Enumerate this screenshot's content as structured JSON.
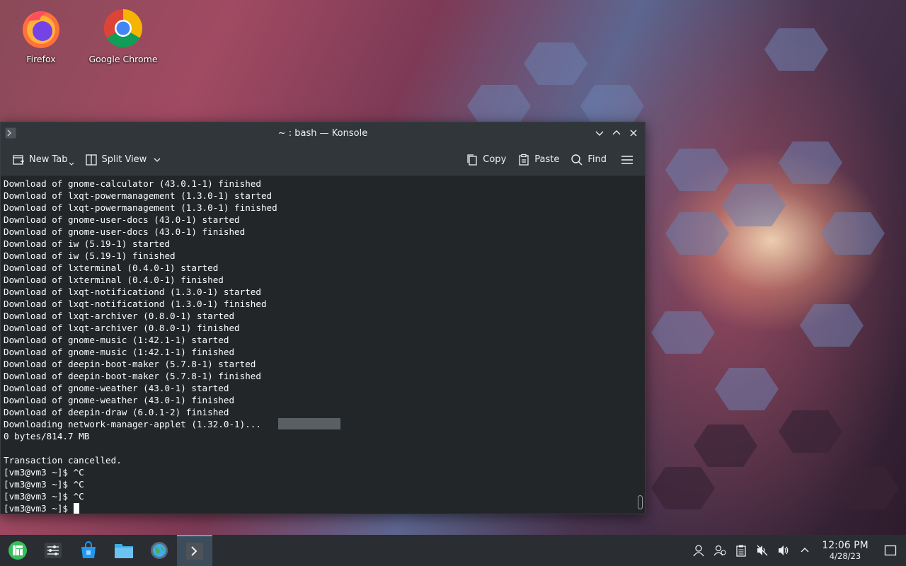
{
  "desktop": {
    "icons": [
      {
        "label": "Firefox",
        "icon": "firefox-icon"
      },
      {
        "label": "Google Chrome",
        "icon": "chrome-icon"
      }
    ]
  },
  "window": {
    "title": "~ : bash — Konsole",
    "toolbar": {
      "new_tab": "New Tab",
      "split_view": "Split View",
      "copy": "Copy",
      "paste": "Paste",
      "find": "Find"
    },
    "terminal_lines": [
      "Download of gnome-calculator (43.0.1-1) finished",
      "Download of lxqt-powermanagement (1.3.0-1) started",
      "Download of lxqt-powermanagement (1.3.0-1) finished",
      "Download of gnome-user-docs (43.0-1) started",
      "Download of gnome-user-docs (43.0-1) finished",
      "Download of iw (5.19-1) started",
      "Download of iw (5.19-1) finished",
      "Download of lxterminal (0.4.0-1) started",
      "Download of lxterminal (0.4.0-1) finished",
      "Download of lxqt-notificationd (1.3.0-1) started",
      "Download of lxqt-notificationd (1.3.0-1) finished",
      "Download of lxqt-archiver (0.8.0-1) started",
      "Download of lxqt-archiver (0.8.0-1) finished",
      "Download of gnome-music (1:42.1-1) started",
      "Download of gnome-music (1:42.1-1) finished",
      "Download of deepin-boot-maker (5.7.8-1) started",
      "Download of deepin-boot-maker (5.7.8-1) finished",
      "Download of gnome-weather (43.0-1) started",
      "Download of gnome-weather (43.0-1) finished",
      "Download of deepin-draw (6.0.1-2) finished"
    ],
    "downloading_line": "Downloading network-manager-applet (1.32.0-1)...",
    "bytes_line": "0 bytes/814.7 MB",
    "cancel_line": "Transaction cancelled.",
    "prompt_lines": [
      "[vm3@vm3 ~]$ ^C",
      "[vm3@vm3 ~]$ ^C",
      "[vm3@vm3 ~]$ ^C"
    ],
    "current_prompt": "[vm3@vm3 ~]$ "
  },
  "taskbar": {
    "clock_time": "12:06 PM",
    "clock_date": "4/28/23"
  }
}
